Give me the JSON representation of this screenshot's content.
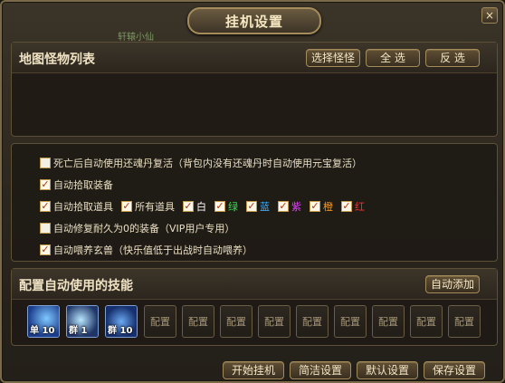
{
  "window": {
    "title": "挂机设置",
    "close": "×",
    "bg_caption": "轩辕小仙"
  },
  "map_panel": {
    "title": "地图怪物列表",
    "buttons": {
      "select_monster": "选择怪怪",
      "select_all": "全 选",
      "invert": "反 选"
    }
  },
  "options": {
    "revive": {
      "label": "死亡后自动使用还魂丹复活（背包内没有还魂丹时自动使用元宝复活）",
      "checked": false
    },
    "pickup_equip": {
      "label": "自动拾取装备",
      "checked": true
    },
    "pickup_items": {
      "label": "自动拾取道具",
      "checked": true
    },
    "filters": [
      {
        "label": "所有道具",
        "checked": true,
        "color": "#eadfc3"
      },
      {
        "label": "白",
        "checked": true,
        "color": "#ffffff"
      },
      {
        "label": "绿",
        "checked": true,
        "color": "#2ee04a"
      },
      {
        "label": "蓝",
        "checked": true,
        "color": "#3fb2ff"
      },
      {
        "label": "紫",
        "checked": true,
        "color": "#e03cff"
      },
      {
        "label": "橙",
        "checked": true,
        "color": "#ff9a1a"
      },
      {
        "label": "红",
        "checked": true,
        "color": "#ff2b2b"
      }
    ],
    "repair": {
      "label": "自动修复耐久为0的装备（VIP用户专用）",
      "checked": false
    },
    "feed_pet": {
      "label": "自动喂养玄兽（快乐值低于出战时自动喂养）",
      "checked": true
    }
  },
  "skills_panel": {
    "title": "配置自动使用的技能",
    "auto_add": "自动添加",
    "skills": [
      {
        "label": "单 10",
        "icon": "lightning-skill-icon",
        "colors": [
          "#1b3c8c",
          "#7ec8ff"
        ]
      },
      {
        "label": "群 1",
        "icon": "storm-skill-icon",
        "colors": [
          "#1f3567",
          "#b8e6ff"
        ]
      },
      {
        "label": "群 10",
        "icon": "frost-skill-icon",
        "colors": [
          "#16306f",
          "#6aa8f0"
        ]
      }
    ],
    "empty_slots": [
      "配置",
      "配置",
      "配置",
      "配置",
      "配置",
      "配置",
      "配置",
      "配置",
      "配置"
    ]
  },
  "footer": {
    "start": "开始挂机",
    "simple": "简洁设置",
    "default": "默认设置",
    "save": "保存设置"
  }
}
